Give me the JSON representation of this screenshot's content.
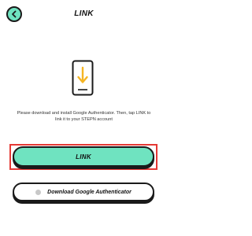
{
  "header": {
    "title": "LINK",
    "back_icon": "back-arrow-icon"
  },
  "main": {
    "illustration_icon": "phone-download-icon",
    "instructions": "Please download and install Google Authenticator. Then, tap LINK to link it to your STEPN account"
  },
  "actions": {
    "link_label": "LINK",
    "download_label": "Download Google Authenticator",
    "download_icon": "google-authenticator-icon"
  },
  "colors": {
    "accent": "#6fe3c0",
    "arrow": "#f5b524",
    "outline": "#1a1a1a",
    "highlight": "#e53935"
  }
}
